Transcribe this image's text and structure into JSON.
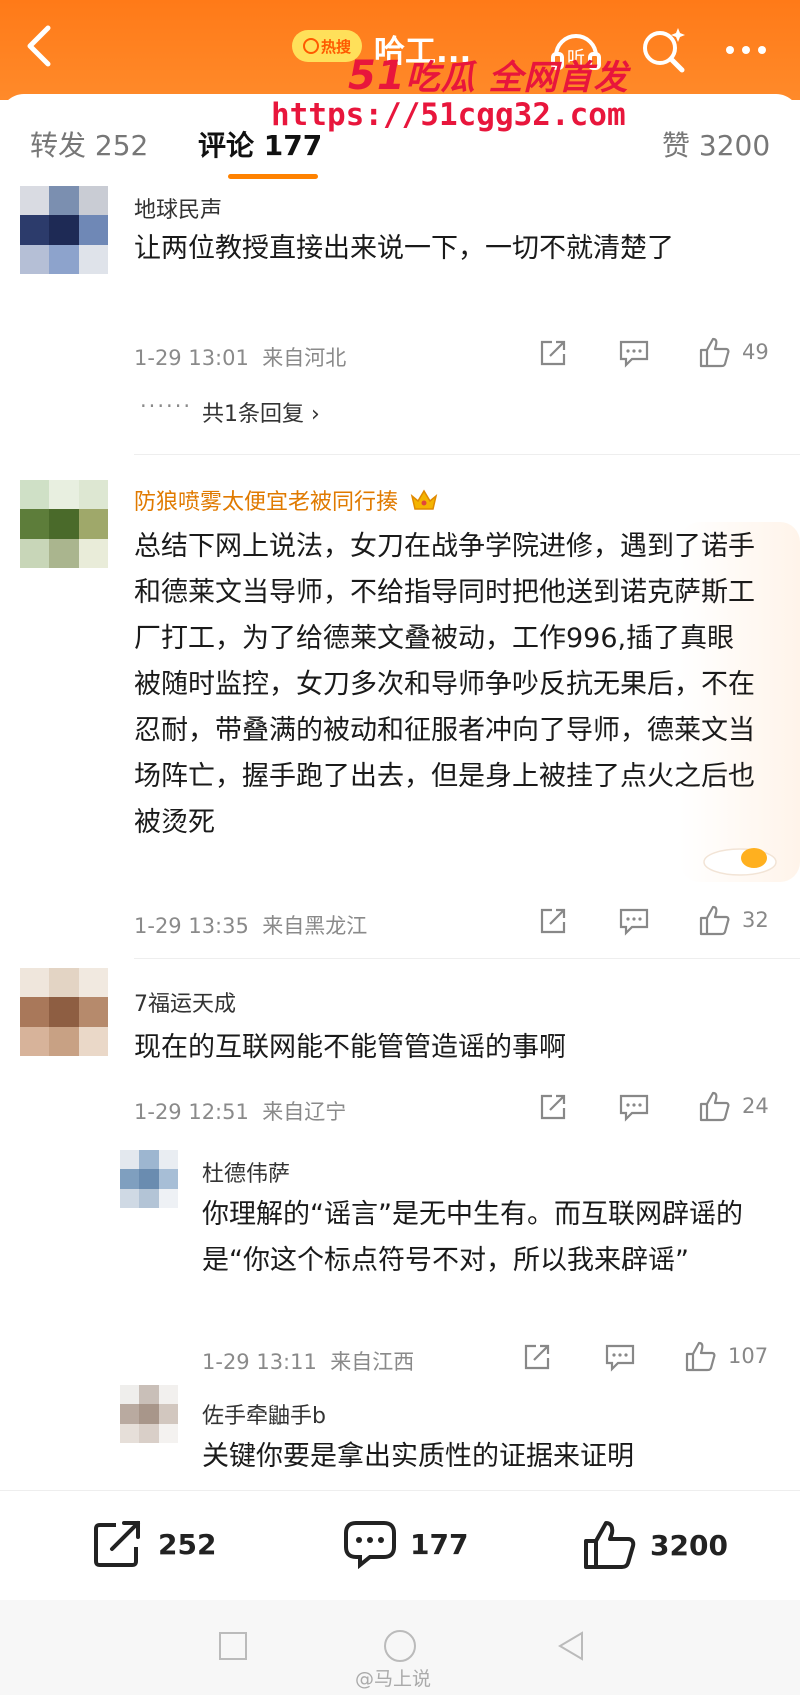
{
  "topbar": {
    "back_icon": "chevron-left-icon",
    "hot_label": "热搜",
    "title": "哈工...",
    "listen_label": "听",
    "icons": [
      "listen-icon",
      "ai-search-icon",
      "more-icon"
    ]
  },
  "tabs": {
    "repost": "转发 252",
    "comments": "评论 177",
    "likes": "赞 3200"
  },
  "watermark": {
    "brand_num": "51",
    "brand_text": "吃瓜 全网首发",
    "url": "https://51cgg32.com"
  },
  "comments": [
    {
      "user": "地球民声",
      "text": "让两位教授直接出来说一下，一切不就清楚了",
      "time": "1-29 13:01",
      "location": "来自河北",
      "likes": "49",
      "more_replies": "共1条回复 ›"
    },
    {
      "user": "防狼喷雾太便宜老被同行揍",
      "badge": "crown-icon",
      "text": "总结下网上说法，女刀在战争学院进修，遇到了诺手和德莱文当导师，不给指导同时把他送到诺克萨斯工厂打工，为了给德莱文叠被动，工作996,插了真眼被随时监控，女刀多次和导师争吵反抗无果后，不在忍耐，带叠满的被动和征服者冲向了导师，德莱文当场阵亡，握手跑了出去，但是身上被挂了点火之后也被烫死",
      "time": "1-29 13:35",
      "location": "来自黑龙江",
      "likes": "32"
    },
    {
      "user": "7福运天成",
      "text": "现在的互联网能不能管管造谣的事啊",
      "time": "1-29 12:51",
      "location": "来自辽宁",
      "likes": "24",
      "replies": [
        {
          "user": "杜德伟萨",
          "text": "你理解的“谣言”是无中生有。而互联网辟谣的是“你这个标点符号不对，所以我来辟谣”",
          "time": "1-29 13:11",
          "location": "来自江西",
          "likes": "107"
        },
        {
          "user": "佐手牵鼬手b",
          "text": "关键你要是拿出实质性的证据来证明"
        }
      ]
    }
  ],
  "bottom_bar": {
    "repost_count": "252",
    "comment_count": "177",
    "like_count": "3200"
  },
  "credit": "@马上说",
  "colors": {
    "header": "#ff7a18",
    "accent": "#ff8200",
    "watermark": "#e8163c",
    "gold_name": "#e07a00"
  }
}
